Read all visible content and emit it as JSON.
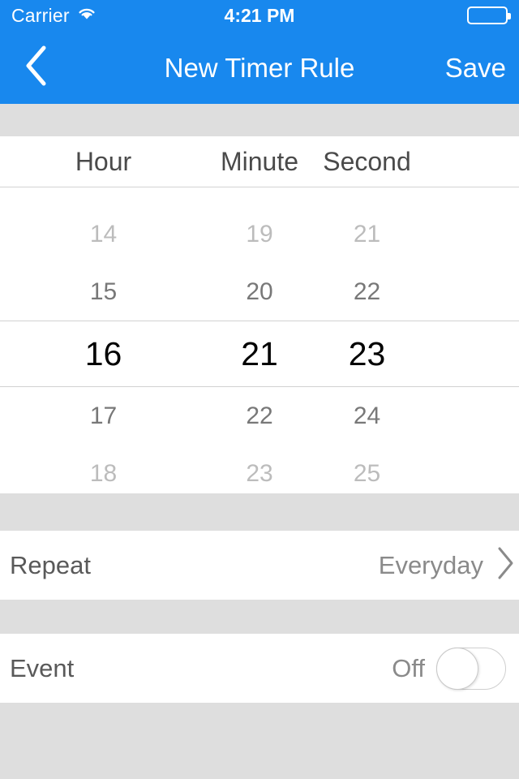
{
  "status_bar": {
    "carrier": "Carrier",
    "wifi_icon": "wifi-icon",
    "time": "4:21 PM",
    "battery_icon": "battery-icon"
  },
  "nav_bar": {
    "back_icon": "chevron-left-icon",
    "title": "New Timer Rule",
    "save_label": "Save",
    "background_color": "#1888ee",
    "text_color": "#ffffff"
  },
  "picker": {
    "columns": [
      {
        "key": "hour",
        "header": "Hour"
      },
      {
        "key": "minute",
        "header": "Minute"
      },
      {
        "key": "second",
        "header": "Second"
      }
    ],
    "rows": [
      {
        "state": "faint",
        "hour": "14",
        "minute": "19",
        "second": "21"
      },
      {
        "state": "dim",
        "hour": "15",
        "minute": "20",
        "second": "22"
      },
      {
        "state": "selected",
        "hour": "16",
        "minute": "21",
        "second": "23"
      },
      {
        "state": "dim",
        "hour": "17",
        "minute": "22",
        "second": "24"
      },
      {
        "state": "faint",
        "hour": "18",
        "minute": "23",
        "second": "25"
      }
    ],
    "selected": {
      "hour": "16",
      "minute": "21",
      "second": "23"
    },
    "colors": {
      "selected_text": "#000000",
      "adjacent_text": "#787878",
      "far_text": "#bcbcbc",
      "separator": "#d2d2d2"
    }
  },
  "settings": {
    "repeat": {
      "label": "Repeat",
      "value": "Everyday",
      "chevron_icon": "chevron-right-icon"
    },
    "event": {
      "label": "Event",
      "value": "Off",
      "toggle_state": "off"
    }
  },
  "page": {
    "background_color": "#dedede",
    "panel_color": "#ffffff"
  }
}
